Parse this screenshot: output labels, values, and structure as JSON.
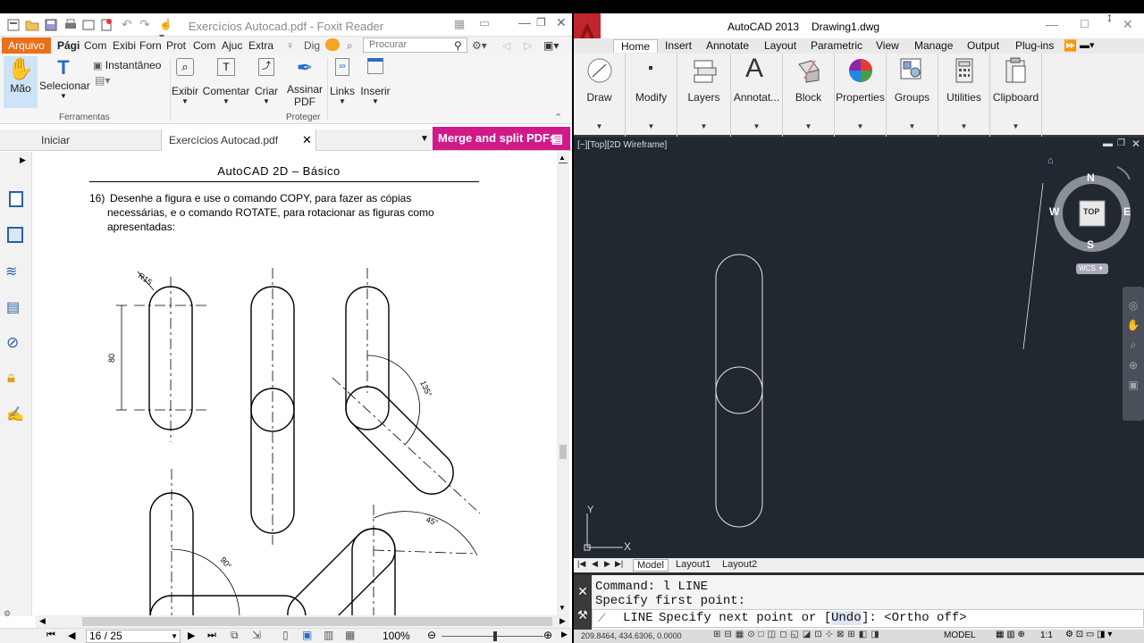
{
  "foxit": {
    "title": "Exercícios Autocad.pdf - Foxit Reader",
    "file_menu": "Arquivo",
    "menu": [
      "Pági",
      "Com",
      "Exibi",
      "Forn",
      "Prot",
      "Com",
      "Ajuc",
      "Extra"
    ],
    "dig": "Dig",
    "search_placeholder": "Procurar",
    "ribbon": {
      "hand": "Mão",
      "select": "Selecionar",
      "snapshot": "Instantâneo",
      "tools_group": "Ferramentas",
      "view": "Exibir",
      "comment": "Comentar",
      "create": "Criar",
      "sign_line1": "Assinar",
      "sign_line2": "PDF",
      "protect_group": "Proteger",
      "links": "Links",
      "insert": "Inserir"
    },
    "tabs": [
      "Iniciar",
      "Exercícios Autocad.pdf"
    ],
    "merge_banner": "Merge and split PDFs",
    "doc": {
      "header": "AutoCAD 2D – Básico",
      "ex_number": "16)",
      "ex_line1": "Desenhe a figura e use o comando COPY, para fazer as cópias",
      "ex_line2": "necessárias, e o comando ROTATE, para rotacionar as figuras como",
      "ex_line3": "apresentadas:",
      "dim_r15": "R15",
      "dim_80": "80",
      "dim_135": "135°",
      "dim_90": "90°",
      "dim_45": "45°"
    },
    "status": {
      "page": "16 / 25",
      "zoom": "100%"
    }
  },
  "acad": {
    "app": "AutoCAD 2013",
    "file": "Drawing1.dwg",
    "tabs": [
      "Home",
      "Insert",
      "Annotate",
      "Layout",
      "Parametric",
      "View",
      "Manage",
      "Output",
      "Plug-ins"
    ],
    "panels": [
      "Draw",
      "Modify",
      "Layers",
      "Annotat...",
      "Block",
      "Properties",
      "Groups",
      "Utilities",
      "Clipboard"
    ],
    "viewport_label": "[−][Top][2D Wireframe]",
    "viewcube": {
      "n": "N",
      "s": "S",
      "e": "E",
      "w": "W",
      "top": "TOP",
      "wcs": "WCS"
    },
    "ucs": {
      "x": "X",
      "y": "Y"
    },
    "layout_tabs": [
      "Model",
      "Layout1",
      "Layout2"
    ],
    "command": {
      "line1": "Command: l LINE",
      "line2": "Specify first point:",
      "prompt_cmd": "LINE",
      "prompt_text": "Specify next point or [",
      "prompt_undo": "Undo",
      "prompt_end": "]:  <Ortho off>"
    },
    "status": {
      "coords": "209.8464, 434.6306, 0.0000",
      "model": "MODEL",
      "scale": "1:1"
    }
  }
}
